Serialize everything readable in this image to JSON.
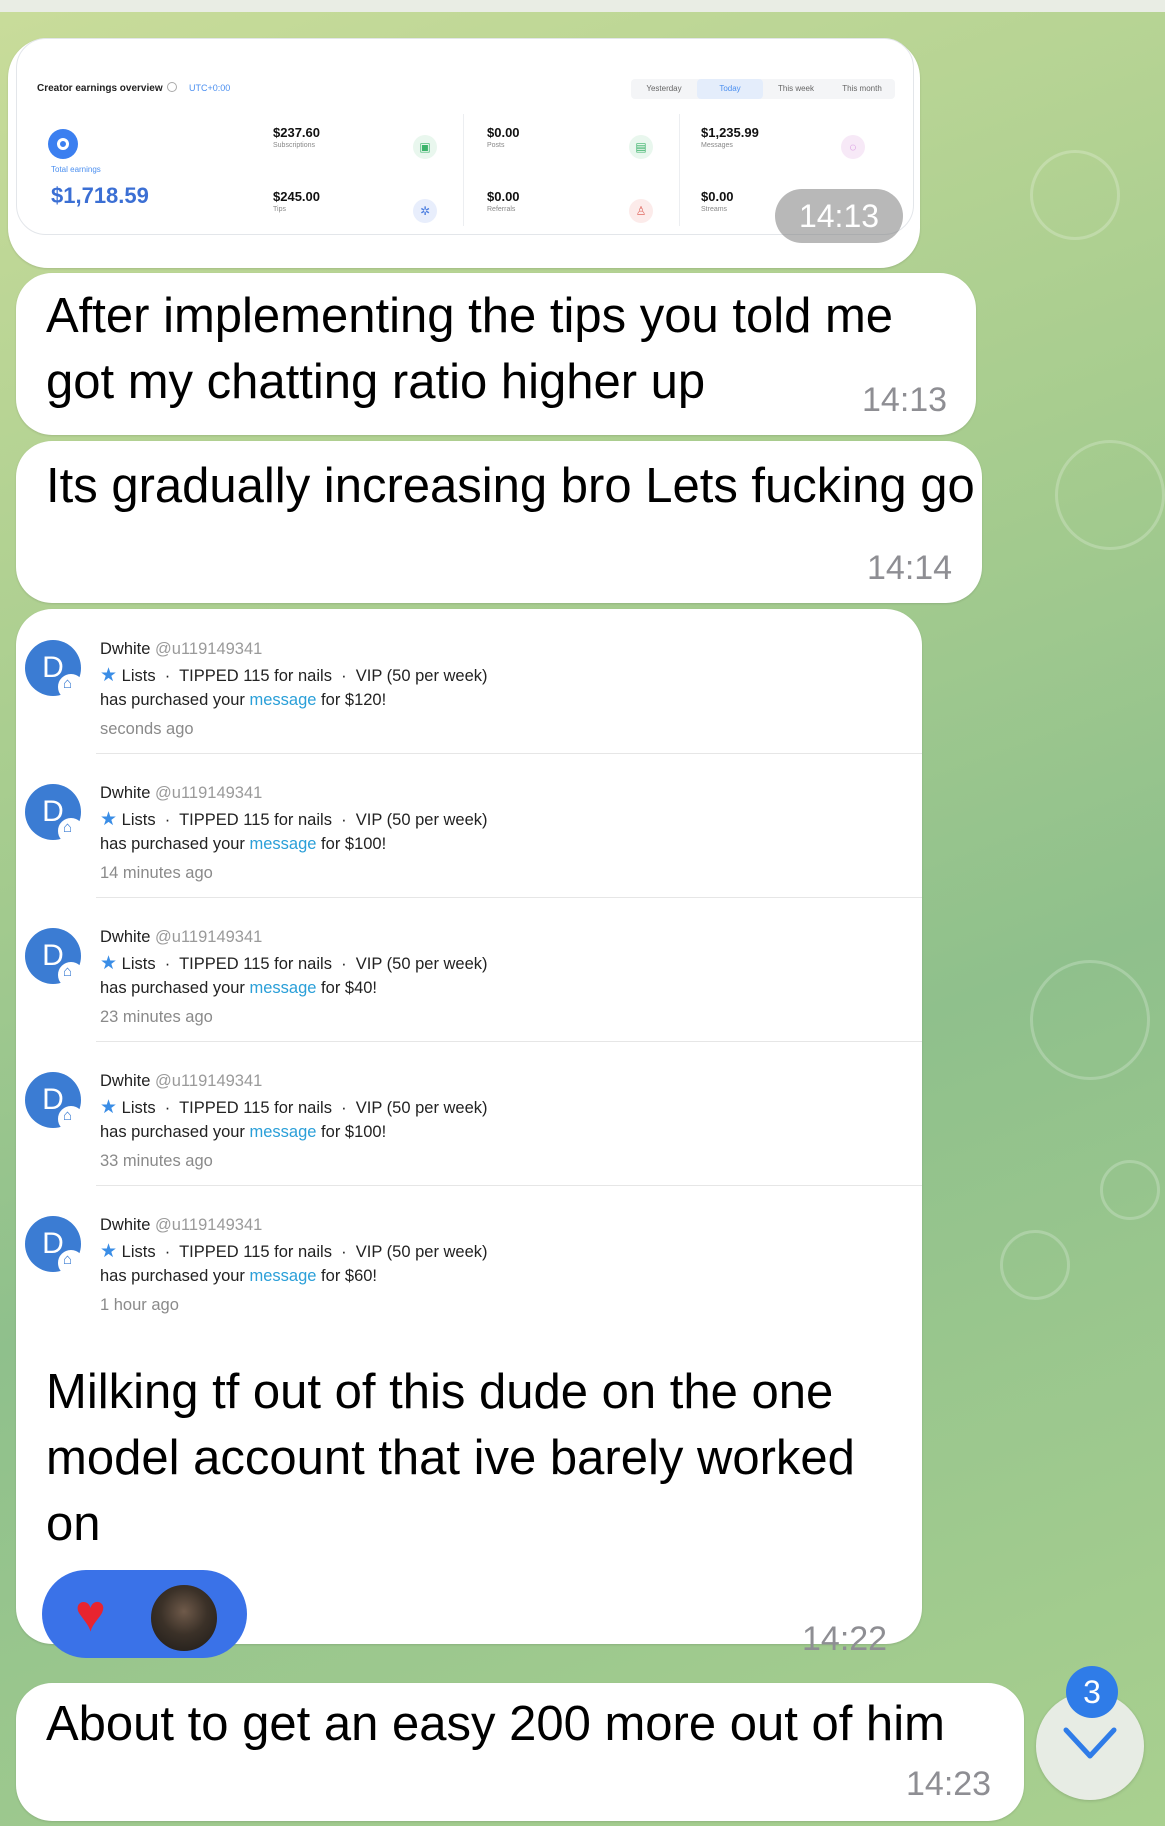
{
  "earnings": {
    "title": "Creator earnings overview",
    "timezone": "UTC+0:00",
    "tabs": [
      "Yesterday",
      "Today",
      "This week",
      "This month"
    ],
    "active_tab": "Today",
    "total_label": "Total earnings",
    "total_value": "$1,718.59",
    "stats": [
      {
        "value": "$237.60",
        "label": "Subscriptions"
      },
      {
        "value": "$0.00",
        "label": "Posts"
      },
      {
        "value": "$1,235.99",
        "label": "Messages"
      },
      {
        "value": "$245.00",
        "label": "Tips"
      },
      {
        "value": "$0.00",
        "label": "Referrals"
      },
      {
        "value": "$0.00",
        "label": "Streams"
      }
    ],
    "time": "14:13"
  },
  "messages": [
    {
      "text": "After implementing the tips you told me got my chatting ratio higher up",
      "time": "14:13"
    },
    {
      "text": "Its gradually increasing bro Lets fucking go",
      "time": "14:14"
    },
    {
      "text": "Milking tf out of this dude on the one model account that ive barely worked on",
      "time": "14:22"
    },
    {
      "text": "About to get an easy 200 more out of him",
      "time": "14:23"
    }
  ],
  "notifications": [
    {
      "name": "Dwhite",
      "handle": "@u119149341",
      "tags": "Lists  ·  TIPPED 115 for nails  ·  VIP (50 per week)",
      "pre": "has purchased your ",
      "link": "message",
      "post": " for $120!",
      "time": "seconds ago",
      "avatar_letter": "D"
    },
    {
      "name": "Dwhite",
      "handle": "@u119149341",
      "tags": "Lists  ·  TIPPED 115 for nails  ·  VIP (50 per week)",
      "pre": "has purchased your ",
      "link": "message",
      "post": " for $100!",
      "time": "14 minutes ago",
      "avatar_letter": "D"
    },
    {
      "name": "Dwhite",
      "handle": "@u119149341",
      "tags": "Lists  ·  TIPPED 115 for nails  ·  VIP (50 per week)",
      "pre": "has purchased your ",
      "link": "message",
      "post": " for $40!",
      "time": "23 minutes ago",
      "avatar_letter": "D"
    },
    {
      "name": "Dwhite",
      "handle": "@u119149341",
      "tags": "Lists  ·  TIPPED 115 for nails  ·  VIP (50 per week)",
      "pre": "has purchased your ",
      "link": "message",
      "post": " for $100!",
      "time": "33 minutes ago",
      "avatar_letter": "D"
    },
    {
      "name": "Dwhite",
      "handle": "@u119149341",
      "tags": "Lists  ·  TIPPED 115 for nails  ·  VIP (50 per week)",
      "pre": "has purchased your ",
      "link": "message",
      "post": " for $60!",
      "time": "1 hour ago",
      "avatar_letter": "D"
    }
  ],
  "reactions": {
    "emoji": "❤️",
    "icons": [
      "heart-icon",
      "reactor-avatar"
    ]
  },
  "scroll": {
    "unread_count": "3",
    "icon": "chevron-down-icon"
  },
  "colors": {
    "accent": "#2f7ce8",
    "bubble": "#ffffff",
    "reaction_bg": "#3a72e8"
  }
}
